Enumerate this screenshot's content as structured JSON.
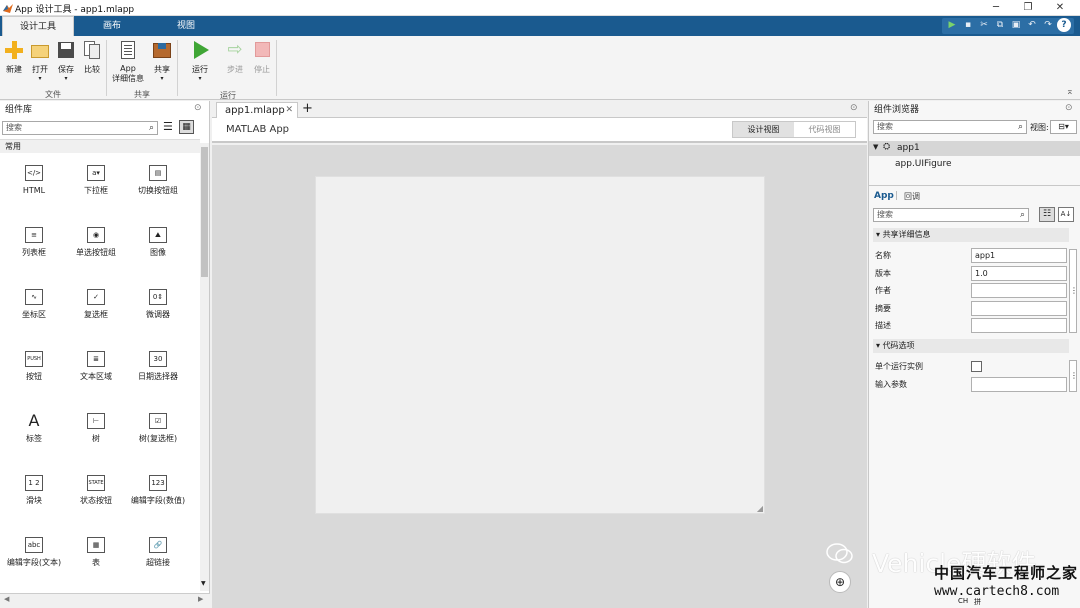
{
  "window": {
    "title": "App 设计工具 - app1.mlapp"
  },
  "ribbon_tabs": [
    "设计工具",
    "画布",
    "视图"
  ],
  "ribbon": {
    "buttons": {
      "new": "新建",
      "open": "打开",
      "save": "保存",
      "compare": "比较",
      "app_details_1": "App",
      "app_details_2": "详细信息",
      "share": "共享",
      "run": "运行",
      "step": "步进",
      "stop": "停止"
    },
    "groups": {
      "file": "文件",
      "share": "共享",
      "run": "运行"
    }
  },
  "library": {
    "title": "组件库",
    "search_placeholder": "搜索",
    "section": "常用",
    "components": [
      {
        "label": "HTML",
        "icon": "html-icon",
        "glyph": "</>"
      },
      {
        "label": "下拉框",
        "icon": "dropdown-icon",
        "glyph": "a▾"
      },
      {
        "label": "切换按钮组",
        "icon": "toggle-button-group-icon",
        "glyph": "▤"
      },
      {
        "label": "列表框",
        "icon": "listbox-icon",
        "glyph": "≡"
      },
      {
        "label": "单选按钮组",
        "icon": "radio-group-icon",
        "glyph": "◉"
      },
      {
        "label": "图像",
        "icon": "image-icon",
        "glyph": "⛰"
      },
      {
        "label": "坐标区",
        "icon": "axes-icon",
        "glyph": "∿"
      },
      {
        "label": "复选框",
        "icon": "checkbox-icon",
        "glyph": "✓"
      },
      {
        "label": "微调器",
        "icon": "spinner-icon",
        "glyph": "0⇕"
      },
      {
        "label": "按钮",
        "icon": "push-button-icon",
        "glyph": "PUSH"
      },
      {
        "label": "文本区域",
        "icon": "text-area-icon",
        "glyph": "≣"
      },
      {
        "label": "日期选择器",
        "icon": "date-picker-icon",
        "glyph": "30"
      },
      {
        "label": "标签",
        "icon": "label-icon",
        "glyph": "A"
      },
      {
        "label": "树",
        "icon": "tree-icon",
        "glyph": "⊢"
      },
      {
        "label": "树(复选框)",
        "icon": "checkbox-tree-icon",
        "glyph": "☑"
      },
      {
        "label": "滑块",
        "icon": "slider-icon",
        "glyph": "1 2"
      },
      {
        "label": "状态按钮",
        "icon": "state-button-icon",
        "glyph": "STATE"
      },
      {
        "label": "编辑字段(数值)",
        "icon": "numeric-field-icon",
        "glyph": "123"
      },
      {
        "label": "编辑字段(文本)",
        "icon": "text-field-icon",
        "glyph": "abc"
      },
      {
        "label": "表",
        "icon": "table-icon",
        "glyph": "▦"
      },
      {
        "label": "超链接",
        "icon": "hyperlink-icon",
        "glyph": "🔗"
      }
    ]
  },
  "document": {
    "tab": "app1.mlapp",
    "app_label": "MATLAB App",
    "design_view": "设计视图",
    "code_view": "代码视图"
  },
  "browser": {
    "title": "组件浏览器",
    "search_placeholder": "搜索",
    "view_label": "视图:",
    "tree": {
      "root": "app1",
      "child": "app.UIFigure"
    },
    "tabs": {
      "app": "App",
      "callback": "回调"
    },
    "inspector_search": "搜索",
    "shared_details": {
      "header": "共享详细信息",
      "fields": [
        {
          "label": "名称",
          "value": "app1"
        },
        {
          "label": "版本",
          "value": "1.0"
        },
        {
          "label": "作者",
          "value": ""
        },
        {
          "label": "摘要",
          "value": ""
        },
        {
          "label": "描述",
          "value": ""
        }
      ]
    },
    "code_options": {
      "header": "代码选项",
      "single_instance": "单个运行实例",
      "input_args": "输入参数"
    }
  },
  "watermark": {
    "text": "Vehicle硬软件",
    "brand": "中国汽车工程师之家",
    "url": "www.cartech8.com"
  },
  "taskbar": {
    "ime": "CH",
    "ime2": "拼"
  }
}
